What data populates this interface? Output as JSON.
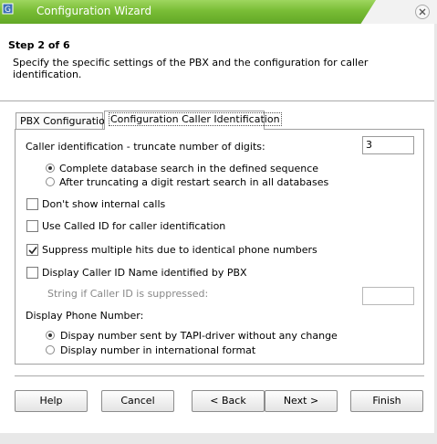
{
  "window": {
    "title": "Configuration Wizard",
    "accent_color": "#79bd36"
  },
  "header": {
    "step": "Step 2 of 6",
    "description": "Specify the specific settings of the PBX and the configuration for caller identification."
  },
  "tabs": [
    {
      "label": "PBX Configuration",
      "active": false
    },
    {
      "label": "Configuration Caller Identification",
      "active": true
    }
  ],
  "caller_id": {
    "truncate_label": "Caller identification - truncate number of digits:",
    "truncate_value": "3",
    "search_options": [
      {
        "label": "Complete database search in the defined sequence",
        "selected": true
      },
      {
        "label": "After truncating a digit restart search in all databases",
        "selected": false
      }
    ]
  },
  "checkboxes": [
    {
      "label": "Don't show internal calls",
      "checked": false
    },
    {
      "label": "Use Called ID for caller identification",
      "checked": false
    },
    {
      "label": "Suppress multiple hits due to identical phone numbers",
      "checked": true
    },
    {
      "label": "Display Caller ID Name identified by PBX",
      "checked": false
    }
  ],
  "suppressed": {
    "label": "String if Caller ID is suppressed:",
    "value": ""
  },
  "display_phone": {
    "heading": "Display Phone Number:",
    "options": [
      {
        "label": "Dispay number sent by TAPI-driver without any change",
        "selected": true
      },
      {
        "label": "Display number in international format",
        "selected": false
      }
    ]
  },
  "buttons": {
    "help": "Help",
    "cancel": "Cancel",
    "back": "< Back",
    "next": "Next >",
    "finish": "Finish"
  }
}
